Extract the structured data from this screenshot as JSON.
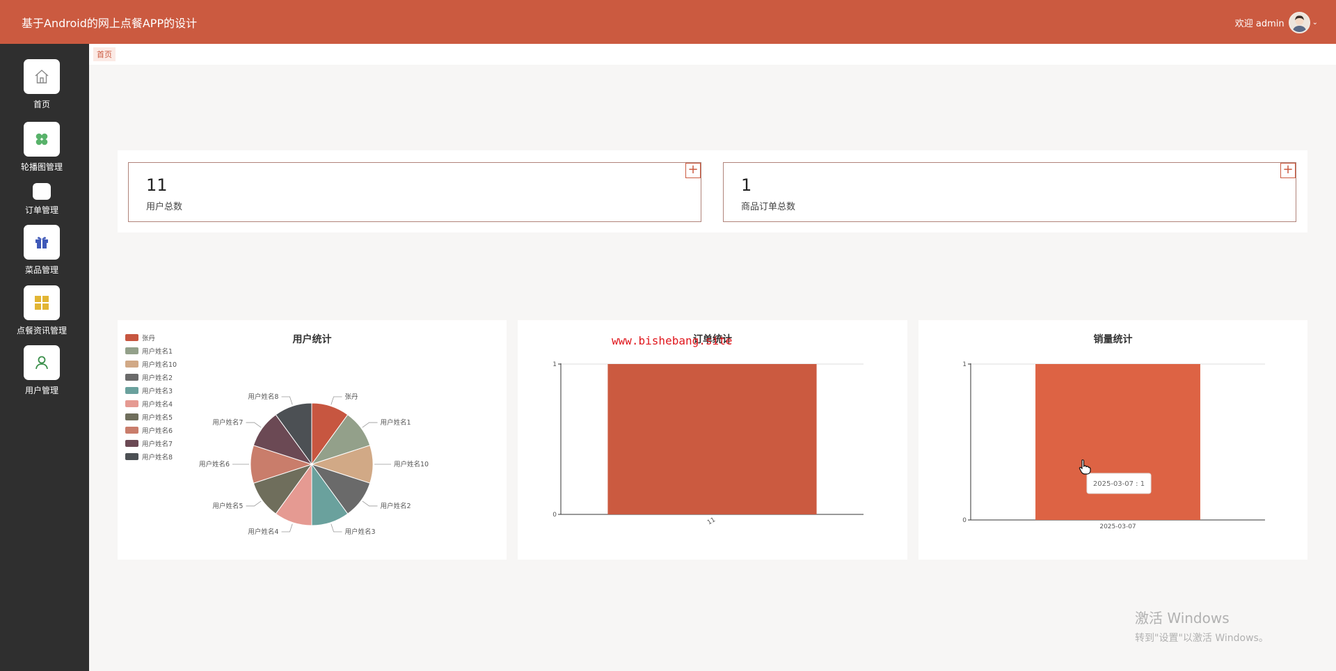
{
  "header": {
    "title": "基于Android的网上点餐APP的设计",
    "welcome": "欢迎 admin"
  },
  "breadcrumb": {
    "home": "首页"
  },
  "sidebar": {
    "items": [
      {
        "label": "首页",
        "icon": "home-icon"
      },
      {
        "label": "轮播图管理",
        "icon": "clover-icon"
      },
      {
        "label": "订单管理",
        "icon": "blank-icon"
      },
      {
        "label": "菜品管理",
        "icon": "gift-icon"
      },
      {
        "label": "点餐资讯管理",
        "icon": "grid-icon"
      },
      {
        "label": "用户管理",
        "icon": "user-icon"
      }
    ]
  },
  "stats": [
    {
      "value": "11",
      "label": "用户总数",
      "button": "+"
    },
    {
      "value": "1",
      "label": "商品订单总数",
      "button": "+"
    }
  ],
  "watermark": "www.bishebang.site",
  "windows_watermark": {
    "line1": "激活 Windows",
    "line2": "转到\"设置\"以激活 Windows。"
  },
  "colors": {
    "accent": "#cb5a40",
    "sidebar": "#2f2f2f"
  },
  "chart_data": [
    {
      "type": "pie",
      "title": "用户统计",
      "categories": [
        "张丹",
        "用户姓名1",
        "用户姓名10",
        "用户姓名2",
        "用户姓名3",
        "用户姓名4",
        "用户姓名5",
        "用户姓名6",
        "用户姓名7",
        "用户姓名8"
      ],
      "values": [
        1,
        1,
        1,
        1,
        1,
        1,
        1,
        1,
        1,
        1
      ],
      "colors": [
        "#c75640",
        "#93a08a",
        "#d1a986",
        "#6a6a6a",
        "#6aa19d",
        "#e59a92",
        "#6f6e5c",
        "#c97d6b",
        "#6b4954",
        "#4c5054"
      ],
      "legend": "top-left"
    },
    {
      "type": "bar",
      "title": "订单统计",
      "categories": [
        "11"
      ],
      "values": [
        1
      ],
      "ylim": [
        0,
        1
      ],
      "yticks": [
        "0",
        "1"
      ],
      "color": "#cb5a40"
    },
    {
      "type": "bar",
      "title": "销量统计",
      "categories": [
        "2025-03-07"
      ],
      "values": [
        1
      ],
      "ylim": [
        0,
        1
      ],
      "yticks": [
        "0",
        "1"
      ],
      "color": "#dd6344",
      "tooltip": "2025-03-07 : 1"
    }
  ]
}
